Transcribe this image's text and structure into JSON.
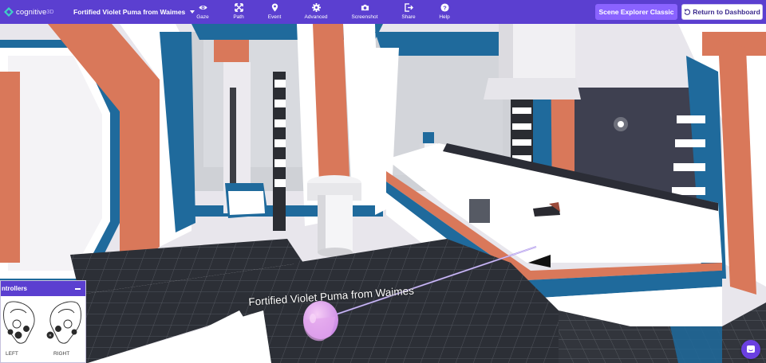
{
  "app": {
    "logo_text": "cognitive",
    "logo_suffix": "3D"
  },
  "header": {
    "session_title": "Fortified Violet Puma from Waimes"
  },
  "toolbar": {
    "items": [
      {
        "label": "Gaze",
        "icon": "eye-icon"
      },
      {
        "label": "Path",
        "icon": "path-icon"
      },
      {
        "label": "Event",
        "icon": "map-pin-icon"
      },
      {
        "label": "Advanced",
        "icon": "gear-icon"
      },
      {
        "label": "Screenshot",
        "icon": "camera-icon"
      },
      {
        "label": "Share",
        "icon": "share-icon"
      },
      {
        "label": "Help",
        "icon": "help-icon"
      }
    ],
    "scene_explorer_label": "Scene Explorer Classic",
    "return_label": "Return to Dashboard"
  },
  "scene": {
    "participant_label": "Fortified Violet Puma from Waimes"
  },
  "controllers_panel": {
    "title": "ntrollers",
    "left_label": "LEFT",
    "right_label": "RIGHT"
  },
  "colors": {
    "header_bg": "#5b3fd0",
    "accent_button": "#8a63ff",
    "chat_button": "#6a3fe0",
    "scene_blue": "#1f6a9c",
    "scene_orange": "#d9785a",
    "head_marker": "#e9a9ef"
  }
}
